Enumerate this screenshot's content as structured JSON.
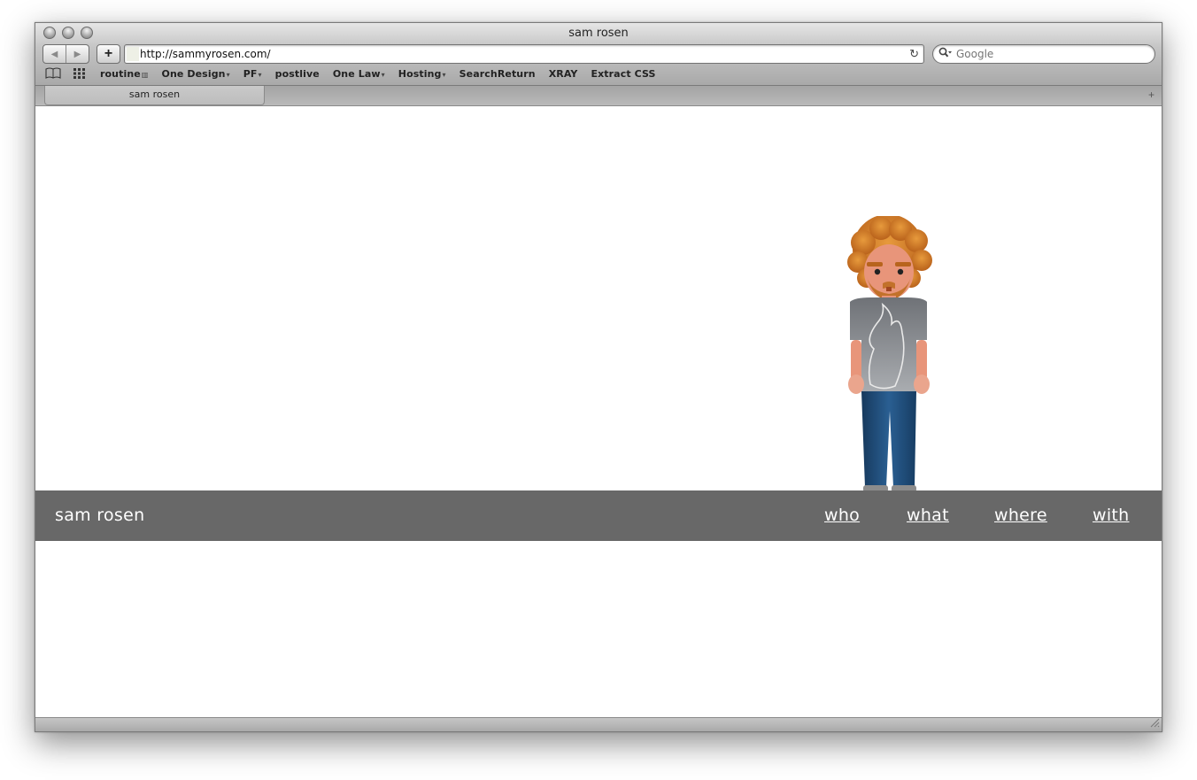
{
  "window": {
    "title": "sam rosen"
  },
  "toolbar": {
    "back_icon": "◀",
    "forward_icon": "▶",
    "add_label": "+",
    "url": "http://sammyrosen.com/",
    "reload_icon": "↻",
    "search_placeholder": "Google",
    "search_icon": "⚲"
  },
  "bookmarks": {
    "book_icon": "📖",
    "grid_icon": "▦",
    "items": [
      {
        "label": "routine",
        "arrow": "▥"
      },
      {
        "label": "One Design",
        "arrow": "▾"
      },
      {
        "label": "PF",
        "arrow": "▾"
      },
      {
        "label": "postlive",
        "arrow": ""
      },
      {
        "label": "One Law",
        "arrow": "▾"
      },
      {
        "label": "Hosting",
        "arrow": "▾"
      },
      {
        "label": "SearchReturn",
        "arrow": ""
      },
      {
        "label": "XRAY",
        "arrow": ""
      },
      {
        "label": "Extract CSS",
        "arrow": ""
      }
    ]
  },
  "tabs": [
    {
      "label": "sam rosen"
    }
  ],
  "newtab_icon": "+",
  "page": {
    "site_name": "sam rosen",
    "nav": [
      "who",
      "what",
      "where",
      "with"
    ]
  },
  "colors": {
    "nav_band": "#686868",
    "hair": "#d9822b",
    "shirt": "#8a8d92",
    "jeans": "#1f4e7a",
    "skin": "#e8957a"
  }
}
